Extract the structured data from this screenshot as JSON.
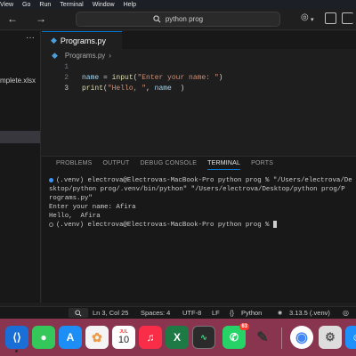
{
  "menubar": {
    "items": [
      "View",
      "Go",
      "Run",
      "Terminal",
      "Window",
      "Help"
    ]
  },
  "titlebar": {
    "search_text": "python prog"
  },
  "sidebar": {
    "more_label": "···",
    "file_label": "mplete.xlsx"
  },
  "editor": {
    "tab_label": "Programs.py",
    "breadcrumb_label": "Programs.py",
    "line_numbers": [
      "1",
      "2",
      "3"
    ],
    "lines": [
      "",
      "name = input(\"Enter your name: \")",
      "print(\"Hello, \", name  )"
    ]
  },
  "panel": {
    "tabs": [
      "PROBLEMS",
      "OUTPUT",
      "DEBUG CONSOLE",
      "TERMINAL",
      "PORTS"
    ],
    "active_tab": "TERMINAL",
    "terminal_lines": [
      "(.venv) electrova@Electrovas-MacBook-Pro python prog % \"/Users/electrova/De",
      "sktop/python prog/.venv/bin/python\" \"/Users/electrova/Desktop/python prog/P",
      "rograms.py\"",
      "Enter your name: Afira",
      "Hello,  Afira",
      "(.venv) electrova@Electrovas-MacBook-Pro python prog % "
    ]
  },
  "statusbar": {
    "position": "Ln 3, Col 25",
    "spaces": "Spaces: 4",
    "encoding": "UTF-8",
    "eol": "LF",
    "language": "Python",
    "interpreter": "3.13.5 (.venv)"
  },
  "dock": {
    "calendar_month": "JUL",
    "calendar_day": "10",
    "whatsapp_badge": "63"
  },
  "colors": {
    "accent": "#0078d4",
    "editor_bg": "#1f1f1f",
    "panel_bg": "#181818",
    "dock_bg": "#8a3550"
  }
}
